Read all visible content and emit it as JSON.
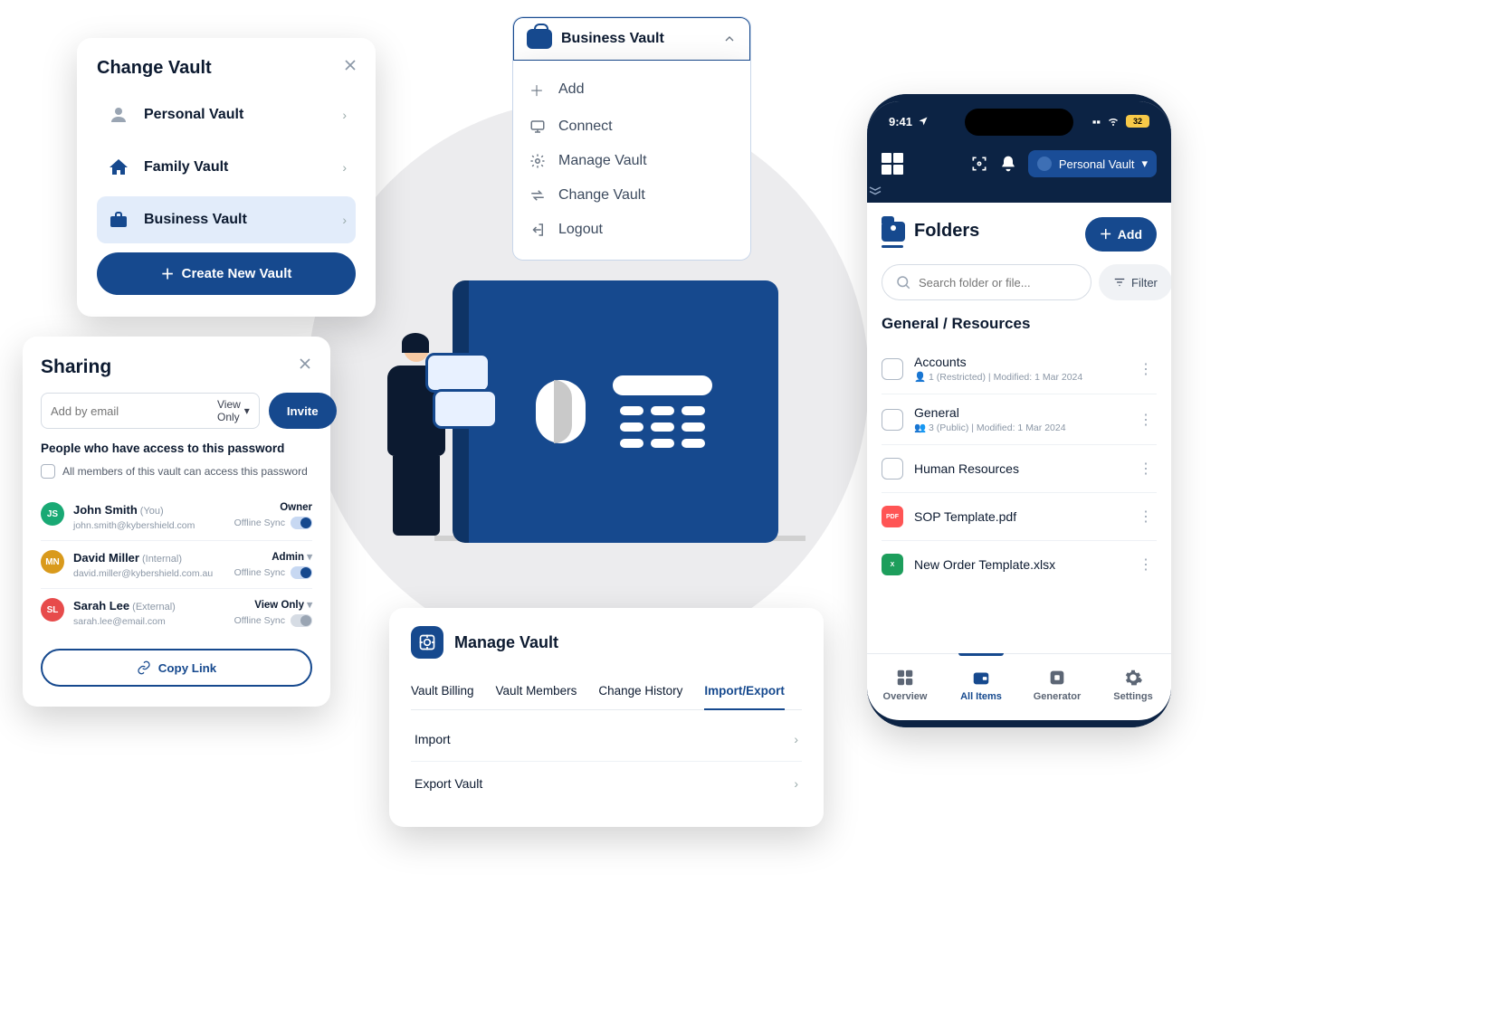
{
  "changeVault": {
    "title": "Change Vault",
    "items": [
      {
        "label": "Personal Vault",
        "icon": "user-circle"
      },
      {
        "label": "Family Vault",
        "icon": "home"
      },
      {
        "label": "Business Vault",
        "icon": "briefcase"
      }
    ],
    "create": "Create New Vault"
  },
  "vaultMenu": {
    "header": "Business Vault",
    "items": [
      {
        "label": "Add",
        "icon": "plus"
      },
      {
        "label": "Connect",
        "icon": "monitor"
      },
      {
        "label": "Manage Vault",
        "icon": "gear"
      },
      {
        "label": "Change Vault",
        "icon": "swap"
      },
      {
        "label": "Logout",
        "icon": "logout"
      }
    ]
  },
  "sharing": {
    "title": "Sharing",
    "emailPlaceholder": "Add by email",
    "roleSelector": "View Only",
    "invite": "Invite",
    "subtitle": "People who have access to this password",
    "allMembers": "All members of this vault can access this password",
    "users": [
      {
        "initials": "JS",
        "name": "John Smith",
        "tag": "(You)",
        "email": "john.smith@kybershield.com",
        "role": "Owner",
        "sync": "Offline Sync",
        "syncOn": true,
        "color": "g"
      },
      {
        "initials": "MN",
        "name": "David Miller",
        "tag": "(Internal)",
        "email": "david.miller@kybershield.com.au",
        "role": "Admin",
        "sync": "Offline Sync",
        "syncOn": true,
        "color": "y"
      },
      {
        "initials": "SL",
        "name": "Sarah Lee",
        "tag": "(External)",
        "email": "sarah.lee@email.com",
        "role": "View Only",
        "sync": "Offline Sync",
        "syncOn": false,
        "color": "r"
      }
    ],
    "copyLink": "Copy Link"
  },
  "manageVault": {
    "title": "Manage Vault",
    "tabs": [
      "Vault Billing",
      "Vault Members",
      "Change History",
      "Import/Export"
    ],
    "activeTab": 3,
    "rows": [
      "Import",
      "Export Vault"
    ]
  },
  "mobile": {
    "time": "9:41",
    "battery": "32",
    "vaultPill": "Personal Vault",
    "foldersTitle": "Folders",
    "add": "Add",
    "searchPlaceholder": "Search folder or file...",
    "filter": "Filter",
    "breadcrumb": "General / Resources",
    "items": [
      {
        "type": "folder",
        "name": "Accounts",
        "meta": "1 (Restricted)  |  Modified: 1 Mar 2024"
      },
      {
        "type": "folder",
        "name": "General",
        "meta": "3 (Public)  |  Modified: 1 Mar 2024"
      },
      {
        "type": "folder",
        "name": "Human Resources",
        "meta": ""
      },
      {
        "type": "pdf",
        "name": "SOP Template.pdf",
        "meta": ""
      },
      {
        "type": "xls",
        "name": "New Order Template.xlsx",
        "meta": ""
      }
    ],
    "nav": [
      {
        "label": "Overview"
      },
      {
        "label": "All Items"
      },
      {
        "label": "Generator"
      },
      {
        "label": "Settings"
      }
    ],
    "activeNav": 1
  }
}
